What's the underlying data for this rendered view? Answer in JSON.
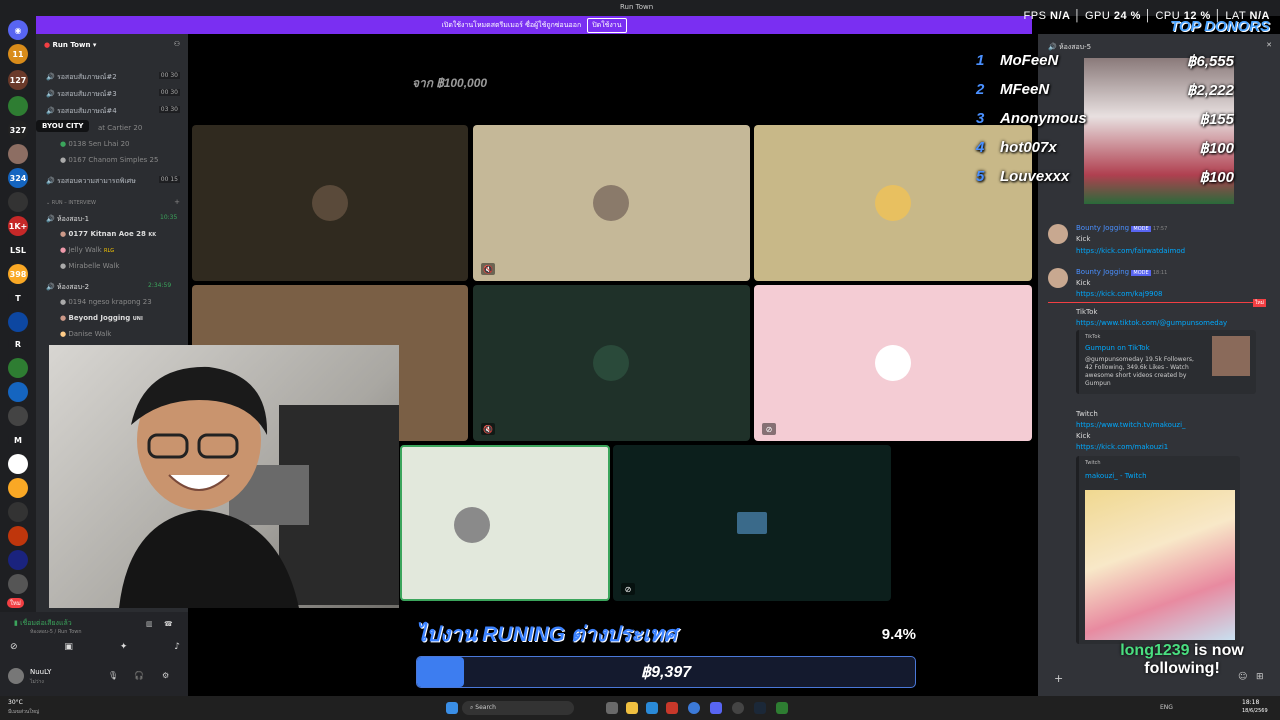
{
  "window": {
    "title": "Run Town"
  },
  "banner": {
    "text": "เปิดใช้งานโหมดสตรีมเมอร์ ซื่อผู้ใช้ถูกซ่อนออก",
    "button": "ปิดใช้งาน"
  },
  "stats": {
    "fps_label": "FPS",
    "fps": "N/A",
    "gpu_label": "GPU",
    "gpu": "24 %",
    "cpu_label": "CPU",
    "cpu": "12 %",
    "lat_label": "LAT",
    "lat": "N/A"
  },
  "server": {
    "name": "Run Town"
  },
  "servers": {
    "badges": [
      "11",
      "127",
      "327",
      "324",
      "1K+",
      "398"
    ],
    "labels": [
      "LSL",
      "T",
      "R",
      "M"
    ],
    "new_badge": "ใหม่"
  },
  "channels": [
    {
      "label": "รอสอบสัมภาษณ์#2",
      "a": "00",
      "b": "30"
    },
    {
      "label": "รอสอบสัมภาษณ์#3",
      "a": "00",
      "b": "30"
    },
    {
      "label": "รอสอบสัมภาษณ์#4",
      "a": "03",
      "b": "30"
    }
  ],
  "tooltip": "BYOU CITY",
  "voice_users_1": [
    "at Cartier 20",
    "0138 Sen Lhai 20",
    "0167 Chanom Simples 25"
  ],
  "channel_exam": {
    "label": "รอสอบความสามารถพิเศษ",
    "a": "00",
    "b": "15"
  },
  "category": "RUN – INTERVIEW",
  "room1": {
    "label": "ห้องสอบ-1",
    "time": "10:35",
    "users": [
      "0177 Kitnan Aoe 28",
      "Jelly Walk",
      "Mirabelle Walk"
    ],
    "tags": [
      "KK",
      "RLG"
    ]
  },
  "room2": {
    "label": "ห้องสอบ-2",
    "time": "2:34:59",
    "users": [
      "0194 ngeso krapong 23",
      "Beyond Jogging",
      "Danise Walk"
    ],
    "tags": [
      "UNI"
    ]
  },
  "userpanel": {
    "status": "เชื่อมต่อเสียงแล้ว",
    "location": "ห้องสอบ-5 / Run Town",
    "name": "NuuLY",
    "substatus": "ไม่ว่าง"
  },
  "donors": {
    "title": "TOP DONORS",
    "list": [
      {
        "rank": "1",
        "name": "MoFeeN",
        "amount": "฿6,555"
      },
      {
        "rank": "2",
        "name": "MFeeN",
        "amount": "฿2,222"
      },
      {
        "rank": "3",
        "name": "Anonymous",
        "amount": "฿155"
      },
      {
        "rank": "4",
        "name": "hot007x",
        "amount": "฿100"
      },
      {
        "rank": "5",
        "name": "Louvexxx",
        "amount": "฿100"
      }
    ]
  },
  "chat": {
    "channel": "ห้องสอบ-5",
    "messages": [
      {
        "user": "Bounty Jogging",
        "badge": "MODE",
        "time": "17:57",
        "text": "Kick",
        "link": "https://kick.com/fairwatdaimod"
      },
      {
        "user": "Bounty Jogging",
        "badge": "MODE",
        "time": "18:11",
        "text": "Kick",
        "link": "https://kick.com/kaj9908"
      }
    ],
    "new_badge": "ใหม่",
    "tiktok": {
      "label": "TikTok",
      "link": "https://www.tiktok.com/@gumpunsomeday",
      "embed_site": "TikTok",
      "embed_title": "Gumpun on TikTok",
      "embed_desc": "@gumpunsomeday 19.5k Followers, 42 Following, 349.6k Likes - Watch awesome short videos created by Gumpun"
    },
    "twitch": {
      "label": "Twitch",
      "link": "https://www.twitch.tv/makouzi_",
      "kick_label": "Kick",
      "kick_link": "https://kick.com/makouzi1",
      "embed_site": "Twitch",
      "embed_title": "makouzi_ - Twitch"
    }
  },
  "goal": {
    "title": "ไปงาน RUNING ต่างประเทศ",
    "percent_text": "9.4%",
    "progress": 0.094,
    "amount": "฿9,397",
    "target": "จาก ฿100,000"
  },
  "follow": {
    "user": "long1239",
    "text1": "is now",
    "text2": "following!"
  },
  "taskbar": {
    "weather": "30°C",
    "weather_desc": "มีเมฆส่วนใหญ่",
    "search": "Search",
    "lang": "ENG",
    "time": "18:18",
    "date": "18/6/2569"
  },
  "colors": {
    "accent": "#5865f2",
    "banner": "#7a2ff2",
    "goal": "#3d7df0"
  }
}
